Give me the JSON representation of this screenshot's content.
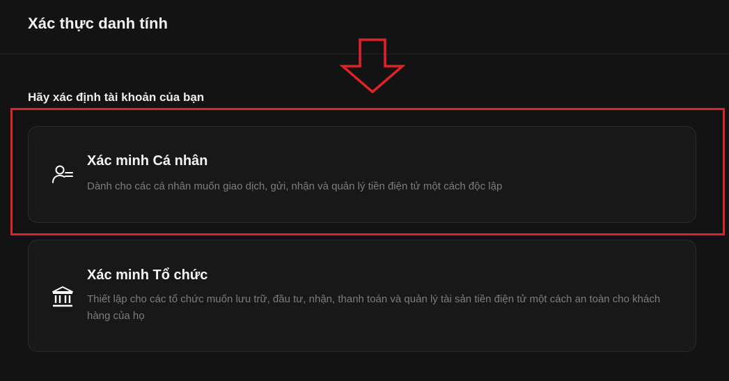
{
  "header": {
    "title": "Xác thực danh tính"
  },
  "section": {
    "label": "Hãy xác định tài khoản của bạn"
  },
  "options": [
    {
      "title": "Xác minh Cá nhân",
      "description": "Dành cho các cá nhân muốn giao dịch, gửi, nhận và quản lý tiền điện tử một cách độc lập",
      "icon": "user-list-icon"
    },
    {
      "title": "Xác minh Tổ chức",
      "description": "Thiết lập cho các tổ chức muốn lưu trữ, đầu tư, nhận, thanh toán và quản lý tài sản tiền điện tử một cách an toàn cho khách hàng của họ",
      "icon": "bank-building-icon"
    }
  ],
  "annotations": {
    "arrow_icon": "down-arrow-outline-icon",
    "arrow_color": "#e0232a",
    "highlight_color": "#e0232a"
  },
  "colors": {
    "background": "#131313",
    "card_background": "#181818",
    "card_border": "#2b2b2b",
    "description_text": "#7d7d7d"
  }
}
